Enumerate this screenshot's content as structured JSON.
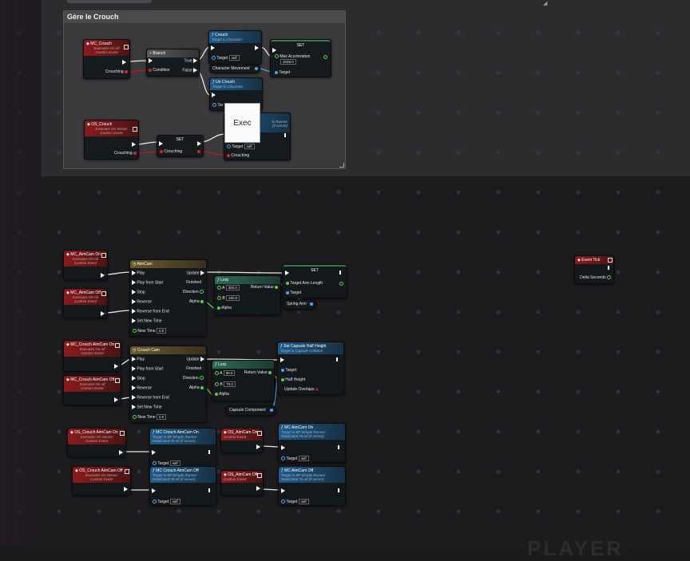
{
  "comment": {
    "title": "Gère le Crouch"
  },
  "tooltip": {
    "label": "Exec"
  },
  "watermark": "PLAYER",
  "nodes": {
    "mc_crouch": {
      "title": "MC_Crouch",
      "sub1": "Executes On All",
      "sub2": "Custom Event",
      "pin": "Crouching"
    },
    "branch": {
      "title": "Branch",
      "true": "True",
      "false": "False",
      "cond": "Condition"
    },
    "crouch": {
      "title": "Crouch",
      "sub": "Target is Character",
      "target": "Target",
      "self": "self"
    },
    "set1": {
      "title": "SET",
      "field": "Max Acceleration",
      "value": "2048.0",
      "target": "Target"
    },
    "char_move": {
      "label": "Character Movement"
    },
    "uncrouch": {
      "title": "Un Crouch",
      "sub": "Target is Character",
      "target": "Tar"
    },
    "os_crouch": {
      "title": "OS_Crouch",
      "sub1": "Executes On Server",
      "sub2": "Custom Event",
      "pin": "Crouching"
    },
    "set2": {
      "title": "SET",
      "pin": "Crouching"
    },
    "hidden_fn": {
      "sub1": "le Runner",
      "sub2": "(if server)",
      "target": "Target",
      "self": "self",
      "pin": "Crouching"
    },
    "mc_aim_on": {
      "title": "MC_AimCam On",
      "sub1": "Executes On All",
      "sub2": "Custom Event"
    },
    "mc_aim_off": {
      "title": "MC_AimCam Off",
      "sub1": "Executes On All",
      "sub2": "Custom Event"
    },
    "aimcam_tl": {
      "title": "AimCam",
      "play": "Play",
      "playstart": "Play from Start",
      "stop": "Stop",
      "reverse": "Reverse",
      "revend": "Reverse from End",
      "setnew": "Set New Time",
      "newtime": "New Time",
      "newtime_val": "0.0",
      "update": "Update",
      "finished": "Finished",
      "direction": "Direction",
      "alpha": "Alpha"
    },
    "lerp1": {
      "title": "Lerp",
      "a": "A",
      "a_val": "300.0",
      "b": "B",
      "b_val": "200.0",
      "alpha": "Alpha",
      "ret": "Return Value"
    },
    "set_arm": {
      "title": "SET",
      "field": "Target Arm Length",
      "target": "Target"
    },
    "spring_arm": {
      "label": "Spring Arm"
    },
    "event_tick": {
      "title": "Event Tick",
      "pin": "Delta Seconds"
    },
    "mc_c_aim_on": {
      "title": "MC_Crouch AimCam On",
      "sub1": "Executes On All",
      "sub2": "Custom Event"
    },
    "mc_c_aim_off": {
      "title": "MC_Crouch AimCam Off",
      "sub1": "Executes On All",
      "sub2": "Custom Event"
    },
    "crouch_tl": {
      "title": "Crouch Cam",
      "play": "Play",
      "playstart": "Play from Start",
      "stop": "Stop",
      "reverse": "Reverse",
      "revend": "Reverse from End",
      "setnew": "Set New Time",
      "newtime": "New Time",
      "newtime_val": "0.0",
      "update": "Update",
      "finished": "Finished",
      "direction": "Direction",
      "alpha": "Alpha"
    },
    "lerp2": {
      "title": "Lerp",
      "a": "A",
      "a_val": "90.0",
      "b": "B",
      "b_val": "70.0",
      "alpha": "Alpha",
      "ret": "Return Value"
    },
    "set_capsule": {
      "title": "Set Capsule Half Height",
      "sub": "Target is Capsule Collision",
      "target": "Target",
      "half": "Half Height",
      "update": "Update Overlaps"
    },
    "capsule_comp": {
      "label": "Capsule Component"
    },
    "os_c_aim_on": {
      "title": "OS_Crouch AimCam On",
      "sub1": "Executes On Server",
      "sub2": "Custom Event"
    },
    "os_c_aim_off": {
      "title": "OS_Crouch AimCam Off",
      "sub1": "Executes On Server",
      "sub2": "Custom Event"
    },
    "fn_c_on": {
      "title": "MC Crouch AimCam On",
      "sub1": "Target is BP Simple Runner",
      "sub2": "Replicated To All (if server)",
      "target": "Target",
      "self": "self"
    },
    "fn_c_off": {
      "title": "MC Crouch AimCam Off",
      "sub1": "Target is BP Simple Runner",
      "sub2": "Replicated To All (if server)",
      "target": "Target",
      "self": "self"
    },
    "os_aim_on": {
      "title": "OS_AimCam On",
      "sub": "Custom Event"
    },
    "os_aim_off": {
      "title": "OS_AimCam Off",
      "sub": "Custom Event"
    },
    "fn_aim_on": {
      "title": "MC AimCam On",
      "sub1": "Target is BP Simple Runner",
      "sub2": "Replicated To All (if server)",
      "target": "Target",
      "self": "self"
    },
    "fn_aim_off": {
      "title": "MC AimCam Off",
      "sub1": "Target is BP Simple Runner",
      "sub2": "Replicated To All (if server)",
      "target": "Target",
      "self": "self"
    }
  }
}
